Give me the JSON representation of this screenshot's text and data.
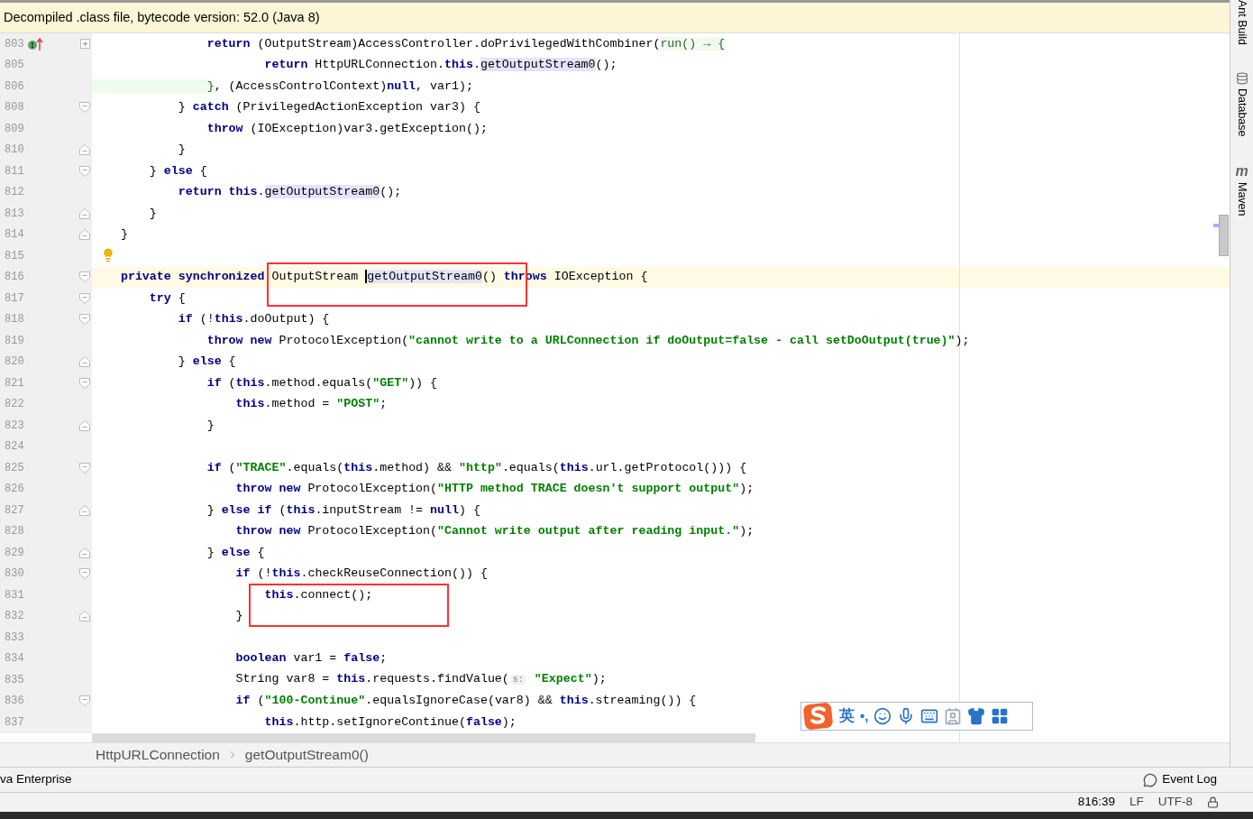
{
  "banner": {
    "text": "Decompiled .class file, bytecode version: 52.0 (Java 8)"
  },
  "editor": {
    "lines": [
      {
        "number": "803",
        "current": false,
        "fold": {
          "kind": "collapsed"
        },
        "marker": {
          "kind": "implements"
        },
        "code": [
          {
            "kind": "kw",
            "text": "                return"
          },
          {
            "kind": "plain",
            "text": " (OutputStream)AccessController.doPrivilegedWithCombiner("
          },
          {
            "kind": "lambda",
            "text": "run() → {"
          }
        ]
      },
      {
        "number": "805",
        "current": false,
        "code": [
          {
            "kind": "kw",
            "text": "                        return"
          },
          {
            "kind": "plain",
            "text": " HttpURLConnection."
          },
          {
            "kind": "kw",
            "text": "this"
          },
          {
            "kind": "plain",
            "text": "."
          },
          {
            "kind": "call",
            "text": "getOutputStream0"
          },
          {
            "kind": "plain",
            "text": "();"
          }
        ]
      },
      {
        "number": "806",
        "current": false,
        "code": [
          {
            "kind": "lambda",
            "text": "                }"
          },
          {
            "kind": "plain",
            "text": ", (AccessControlContext)"
          },
          {
            "kind": "kw",
            "text": "null"
          },
          {
            "kind": "plain",
            "text": ", var1);"
          }
        ]
      },
      {
        "number": "808",
        "current": false,
        "fold": {
          "kind": "open"
        },
        "code": [
          {
            "kind": "plain",
            "text": "            } "
          },
          {
            "kind": "kw",
            "text": "catch"
          },
          {
            "kind": "plain",
            "text": " (PrivilegedActionException var3) {"
          }
        ]
      },
      {
        "number": "809",
        "current": false,
        "code": [
          {
            "kind": "kw",
            "text": "                throw"
          },
          {
            "kind": "plain",
            "text": " (IOException)var3.getException();"
          }
        ]
      },
      {
        "number": "810",
        "current": false,
        "fold": {
          "kind": "close"
        },
        "code": [
          {
            "kind": "plain",
            "text": "            }"
          }
        ]
      },
      {
        "number": "811",
        "current": false,
        "fold": {
          "kind": "open"
        },
        "code": [
          {
            "kind": "plain",
            "text": "        } "
          },
          {
            "kind": "kw",
            "text": "else"
          },
          {
            "kind": "plain",
            "text": " {"
          }
        ]
      },
      {
        "number": "812",
        "current": false,
        "code": [
          {
            "kind": "kw",
            "text": "            return this"
          },
          {
            "kind": "plain",
            "text": "."
          },
          {
            "kind": "call",
            "text": "getOutputStream0"
          },
          {
            "kind": "plain",
            "text": "();"
          }
        ]
      },
      {
        "number": "813",
        "current": false,
        "fold": {
          "kind": "close"
        },
        "code": [
          {
            "kind": "plain",
            "text": "        }"
          }
        ]
      },
      {
        "number": "814",
        "current": false,
        "fold": {
          "kind": "close"
        },
        "code": [
          {
            "kind": "plain",
            "text": "    }"
          }
        ]
      },
      {
        "number": "815",
        "current": false,
        "marker": {
          "kind": "bulb"
        }
      },
      {
        "number": "816",
        "current": true,
        "fold": {
          "kind": "open"
        },
        "code": [
          {
            "kind": "kw",
            "text": "    private synchronized"
          },
          {
            "kind": "plain",
            "text": " OutputStream "
          },
          {
            "kind": "call",
            "text": "getOutputStream0",
            "caret": true
          },
          {
            "kind": "plain",
            "text": "() "
          },
          {
            "kind": "kw",
            "text": "throws"
          },
          {
            "kind": "plain",
            "text": " IOException {"
          }
        ]
      },
      {
        "number": "817",
        "current": false,
        "fold": {
          "kind": "open"
        },
        "code": [
          {
            "kind": "kw",
            "text": "        try"
          },
          {
            "kind": "plain",
            "text": " {"
          }
        ]
      },
      {
        "number": "818",
        "current": false,
        "fold": {
          "kind": "open"
        },
        "code": [
          {
            "kind": "kw",
            "text": "            if"
          },
          {
            "kind": "plain",
            "text": " (!"
          },
          {
            "kind": "kw",
            "text": "this"
          },
          {
            "kind": "plain",
            "text": ".doOutput) {"
          }
        ]
      },
      {
        "number": "819",
        "current": false,
        "code": [
          {
            "kind": "kw",
            "text": "                throw new"
          },
          {
            "kind": "plain",
            "text": " ProtocolException("
          },
          {
            "kind": "str",
            "text": "\"cannot write to a URLConnection if doOutput=false - call setDoOutput(true)\""
          },
          {
            "kind": "plain",
            "text": ");"
          }
        ]
      },
      {
        "number": "820",
        "current": false,
        "fold": {
          "kind": "close"
        },
        "code": [
          {
            "kind": "plain",
            "text": "            } "
          },
          {
            "kind": "kw",
            "text": "else"
          },
          {
            "kind": "plain",
            "text": " {"
          }
        ]
      },
      {
        "number": "821",
        "current": false,
        "fold": {
          "kind": "open"
        },
        "code": [
          {
            "kind": "kw",
            "text": "                if"
          },
          {
            "kind": "plain",
            "text": " ("
          },
          {
            "kind": "kw",
            "text": "this"
          },
          {
            "kind": "plain",
            "text": ".method.equals("
          },
          {
            "kind": "str",
            "text": "\"GET\""
          },
          {
            "kind": "plain",
            "text": ")) {"
          }
        ]
      },
      {
        "number": "822",
        "current": false,
        "code": [
          {
            "kind": "kw",
            "text": "                    this"
          },
          {
            "kind": "plain",
            "text": ".method = "
          },
          {
            "kind": "str",
            "text": "\"POST\""
          },
          {
            "kind": "plain",
            "text": ";"
          }
        ]
      },
      {
        "number": "823",
        "current": false,
        "fold": {
          "kind": "close"
        },
        "code": [
          {
            "kind": "plain",
            "text": "                }"
          }
        ]
      },
      {
        "number": "824",
        "current": false
      },
      {
        "number": "825",
        "current": false,
        "fold": {
          "kind": "open"
        },
        "code": [
          {
            "kind": "kw",
            "text": "                if"
          },
          {
            "kind": "plain",
            "text": " ("
          },
          {
            "kind": "str",
            "text": "\"TRACE\""
          },
          {
            "kind": "plain",
            "text": ".equals("
          },
          {
            "kind": "kw",
            "text": "this"
          },
          {
            "kind": "plain",
            "text": ".method) && "
          },
          {
            "kind": "str",
            "text": "\"http\""
          },
          {
            "kind": "plain",
            "text": ".equals("
          },
          {
            "kind": "kw",
            "text": "this"
          },
          {
            "kind": "plain",
            "text": ".url.getProtocol())) {"
          }
        ]
      },
      {
        "number": "826",
        "current": false,
        "code": [
          {
            "kind": "kw",
            "text": "                    throw new"
          },
          {
            "kind": "plain",
            "text": " ProtocolException("
          },
          {
            "kind": "str",
            "text": "\"HTTP method TRACE doesn't support output\""
          },
          {
            "kind": "plain",
            "text": ");"
          }
        ]
      },
      {
        "number": "827",
        "current": false,
        "fold": {
          "kind": "close"
        },
        "code": [
          {
            "kind": "plain",
            "text": "                } "
          },
          {
            "kind": "kw",
            "text": "else if"
          },
          {
            "kind": "plain",
            "text": " ("
          },
          {
            "kind": "kw",
            "text": "this"
          },
          {
            "kind": "plain",
            "text": ".inputStream != "
          },
          {
            "kind": "kw",
            "text": "null"
          },
          {
            "kind": "plain",
            "text": ") {"
          }
        ]
      },
      {
        "number": "828",
        "current": false,
        "code": [
          {
            "kind": "kw",
            "text": "                    throw new"
          },
          {
            "kind": "plain",
            "text": " ProtocolException("
          },
          {
            "kind": "str",
            "text": "\"Cannot write output after reading input.\""
          },
          {
            "kind": "plain",
            "text": ");"
          }
        ]
      },
      {
        "number": "829",
        "current": false,
        "fold": {
          "kind": "close"
        },
        "code": [
          {
            "kind": "plain",
            "text": "                } "
          },
          {
            "kind": "kw",
            "text": "else"
          },
          {
            "kind": "plain",
            "text": " {"
          }
        ]
      },
      {
        "number": "830",
        "current": false,
        "fold": {
          "kind": "open"
        },
        "code": [
          {
            "kind": "kw",
            "text": "                    if"
          },
          {
            "kind": "plain",
            "text": " (!"
          },
          {
            "kind": "kw",
            "text": "this"
          },
          {
            "kind": "plain",
            "text": ".checkReuseConnection()) {"
          }
        ]
      },
      {
        "number": "831",
        "current": false,
        "code": [
          {
            "kind": "kw",
            "text": "                        this"
          },
          {
            "kind": "plain",
            "text": ".connect();"
          }
        ]
      },
      {
        "number": "832",
        "current": false,
        "fold": {
          "kind": "close"
        },
        "code": [
          {
            "kind": "plain",
            "text": "                    }"
          }
        ]
      },
      {
        "number": "833",
        "current": false
      },
      {
        "number": "834",
        "current": false,
        "code": [
          {
            "kind": "kw",
            "text": "                    boolean"
          },
          {
            "kind": "plain",
            "text": " var1 = "
          },
          {
            "kind": "kw",
            "text": "false"
          },
          {
            "kind": "plain",
            "text": ";"
          }
        ]
      },
      {
        "number": "835",
        "current": false,
        "code": [
          {
            "kind": "plain",
            "text": "                    String var8 = "
          },
          {
            "kind": "kw",
            "text": "this"
          },
          {
            "kind": "plain",
            "text": ".requests.findValue("
          },
          {
            "kind": "hint",
            "text": "s:"
          },
          {
            "kind": "str",
            "text": " \"Expect\""
          },
          {
            "kind": "plain",
            "text": ");"
          }
        ]
      },
      {
        "number": "836",
        "current": false,
        "fold": {
          "kind": "open"
        },
        "code": [
          {
            "kind": "kw",
            "text": "                    if"
          },
          {
            "kind": "plain",
            "text": " ("
          },
          {
            "kind": "str",
            "text": "\"100-Continue\""
          },
          {
            "kind": "plain",
            "text": ".equalsIgnoreCase(var8) && "
          },
          {
            "kind": "kw",
            "text": "this"
          },
          {
            "kind": "plain",
            "text": ".streaming()) {"
          }
        ]
      },
      {
        "number": "837",
        "current": false,
        "code": [
          {
            "kind": "kw",
            "text": "                        this"
          },
          {
            "kind": "plain",
            "text": ".http.setIgnoreContinue("
          },
          {
            "kind": "kw",
            "text": "false"
          },
          {
            "kind": "plain",
            "text": ");"
          }
        ]
      }
    ]
  },
  "right_toolbar": [
    {
      "kind": "ant",
      "label": "Ant Build"
    },
    {
      "kind": "database",
      "label": "Database"
    },
    {
      "kind": "maven",
      "label": "Maven",
      "icon_text": "m"
    }
  ],
  "ime_toolbar": {
    "mode": "英",
    "punctuation": "•,"
  },
  "breadcrumb": [
    "HttpURLConnection",
    "getOutputStream0()"
  ],
  "status_bar": {
    "left": "va Enterprise",
    "event_log": "Event Log"
  },
  "info_bar": {
    "position": "816:39",
    "line_separator": "LF",
    "encoding": "UTF-8"
  }
}
